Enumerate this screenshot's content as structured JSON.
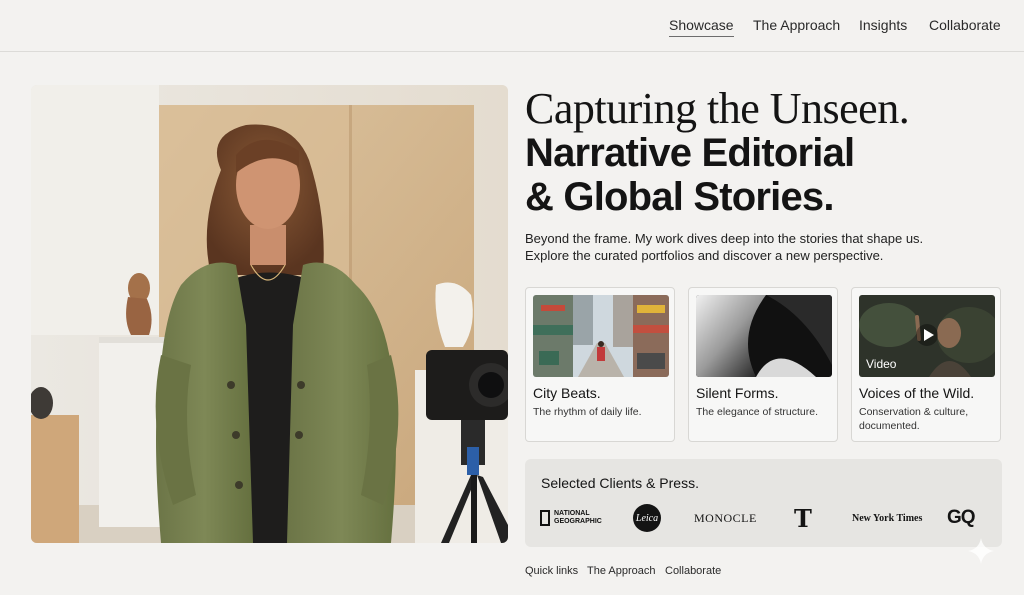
{
  "nav": {
    "items": [
      "Showcase",
      "The Approach",
      "Insights",
      "Collaborate"
    ],
    "active": "Showcase"
  },
  "hero": {
    "headline_line1": "Capturing the Unseen.",
    "headline_line2": "Narrative Editorial",
    "headline_line3": "& Global Stories.",
    "intro_line1": "Beyond the frame. My work dives deep into the stories that shape us.",
    "intro_line2": "Explore the curated portfolios and discover a new perspective."
  },
  "cards": [
    {
      "title": "City Beats.",
      "subtitle": "The rhythm of daily life.",
      "icon": "city-street-photo"
    },
    {
      "title": "Silent Forms.",
      "subtitle": "The elegance of structure.",
      "icon": "abstract-form-photo"
    },
    {
      "title": "Voices of the Wild.",
      "subtitle": "Conservation & culture, documented.",
      "icon": "video-still",
      "badge": "Video"
    }
  ],
  "clients": {
    "title": "Selected Clients & Press.",
    "logos": [
      {
        "name": "national-geographic",
        "line1": "NATIONAL",
        "line2": "GEOGRAPHIC"
      },
      {
        "name": "leica",
        "text": "Leica"
      },
      {
        "name": "monocle",
        "text": "MONOCLE"
      },
      {
        "name": "nyt-t",
        "text": "T"
      },
      {
        "name": "new-york-times",
        "text": "New York Times"
      },
      {
        "name": "gq",
        "text": "GQ"
      }
    ]
  },
  "footer": {
    "links": [
      "Quick links",
      "The Approach",
      "Collaborate"
    ]
  },
  "colors": {
    "background": "#f3f2f0",
    "text": "#141414",
    "card_border": "#d8d7d4",
    "clients_panel": "#e6e5e2",
    "jacket": "#76804f"
  }
}
